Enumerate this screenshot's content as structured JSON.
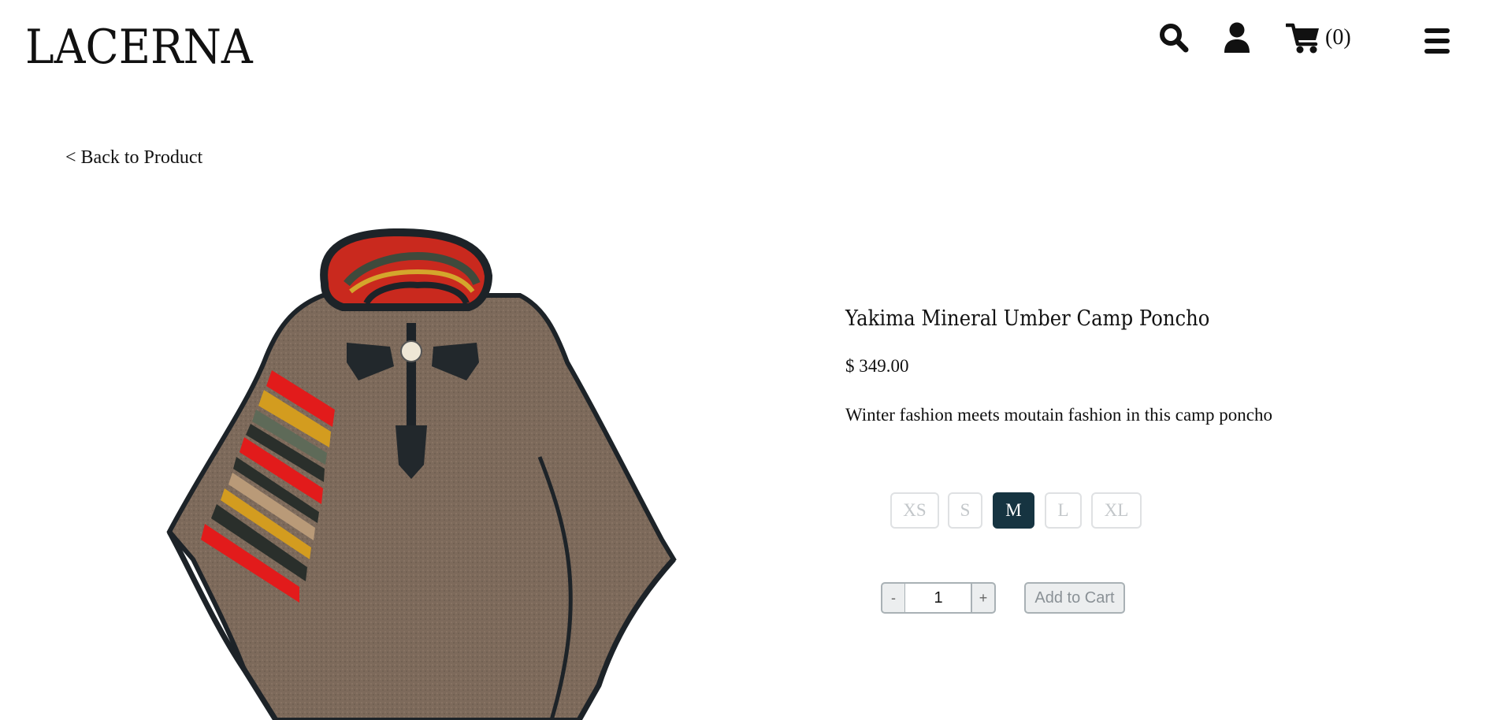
{
  "brand": {
    "logo_text": "LACERNA"
  },
  "header": {
    "icons": [
      "search-icon",
      "user-icon",
      "cart-icon",
      "menu-icon"
    ],
    "cart_count": "(0)"
  },
  "nav": {
    "back_label": "< Back to Product"
  },
  "product": {
    "title": "Yakima Mineral Umber Camp Poncho",
    "price": "$ 349.00",
    "description": "Winter fashion meets moutain fashion in this camp poncho",
    "image_subject": "poncho-image",
    "sizes": [
      {
        "label": "XS",
        "selected": false
      },
      {
        "label": "S",
        "selected": false
      },
      {
        "label": "M",
        "selected": true
      },
      {
        "label": "L",
        "selected": false
      },
      {
        "label": "XL",
        "selected": false
      }
    ],
    "quantity": {
      "minus_label": "-",
      "value": "1",
      "plus_label": "+"
    },
    "add_to_cart_label": "Add to Cart"
  },
  "colors": {
    "selected_size_bg": "#163441",
    "disabled_text": "#c3c7ca",
    "button_bg": "#eceeef",
    "button_border": "#a9b1b5"
  }
}
